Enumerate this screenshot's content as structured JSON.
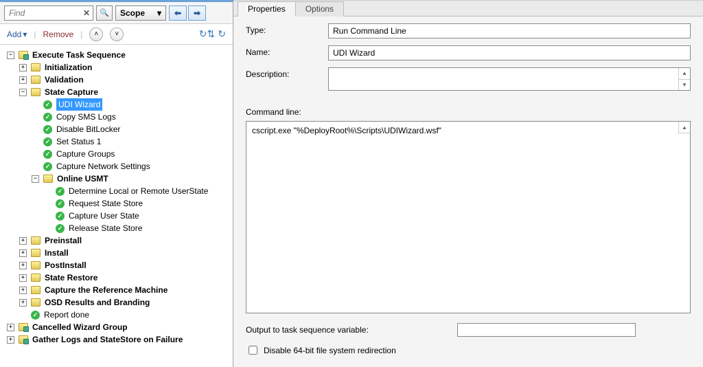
{
  "toolbar": {
    "search_placeholder": "Find",
    "scope_label": "Scope"
  },
  "actions": {
    "add": "Add",
    "remove": "Remove"
  },
  "tree": {
    "root": "Execute Task Sequence",
    "l1": {
      "init": "Initialization",
      "validation": "Validation",
      "state_capture": "State Capture",
      "preinstall": "Preinstall",
      "install": "Install",
      "postinstall": "PostInstall",
      "state_restore": "State Restore",
      "capture_ref": "Capture the Reference Machine",
      "osd": "OSD Results and Branding",
      "report_done": "Report done"
    },
    "sc": {
      "udi": "UDI Wizard",
      "copy_sms": "Copy SMS Logs",
      "disable_bl": "Disable BitLocker",
      "set_status": "Set Status 1",
      "cap_groups": "Capture Groups",
      "cap_net": "Capture Network Settings",
      "online_usmt": "Online USMT"
    },
    "usmt": {
      "determine": "Determine Local or Remote UserState",
      "request": "Request State Store",
      "capture": "Capture User State",
      "release": "Release State Store"
    },
    "cancelled": "Cancelled Wizard Group",
    "gather": "Gather Logs and StateStore on Failure"
  },
  "tabs": {
    "properties": "Properties",
    "options": "Options"
  },
  "form": {
    "type_label": "Type:",
    "type_value": "Run Command Line",
    "name_label": "Name:",
    "name_value": "UDI Wizard",
    "desc_label": "Description:",
    "desc_value": "",
    "cmd_label": "Command line:",
    "cmd_value": "cscript.exe \"%DeployRoot%\\Scripts\\UDIWizard.wsf\"",
    "output_label": "Output to task sequence variable:",
    "output_value": "",
    "disable64": "Disable 64-bit file system redirection"
  }
}
